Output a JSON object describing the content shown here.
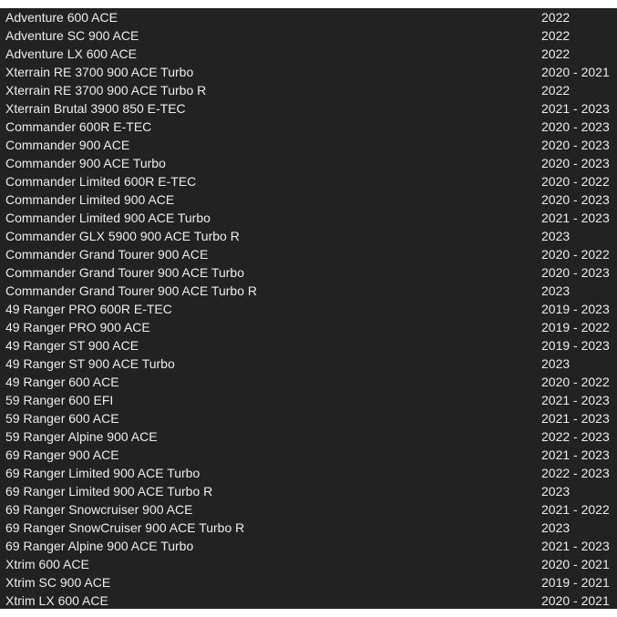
{
  "rows": [
    {
      "model": "Adventure 600 ACE",
      "years": "2022"
    },
    {
      "model": "Adventure SC 900 ACE",
      "years": "2022"
    },
    {
      "model": "Adventure LX 600 ACE",
      "years": "2022"
    },
    {
      "model": "Xterrain RE 3700 900 ACE Turbo",
      "years": "2020 - 2021"
    },
    {
      "model": "Xterrain RE 3700 900 ACE Turbo R",
      "years": "2022"
    },
    {
      "model": "Xterrain Brutal 3900 850 E-TEC",
      "years": "2021 - 2023"
    },
    {
      "model": "Commander 600R E-TEC",
      "years": "2020 - 2023"
    },
    {
      "model": "Commander 900 ACE",
      "years": "2020 - 2023"
    },
    {
      "model": "Commander 900 ACE Turbo",
      "years": "2020 - 2023"
    },
    {
      "model": "Commander Limited 600R E-TEC",
      "years": "2020 - 2022"
    },
    {
      "model": "Commander Limited 900 ACE",
      "years": "2020 - 2023"
    },
    {
      "model": "Commander Limited 900 ACE Turbo",
      "years": "2021 - 2023"
    },
    {
      "model": "Commander GLX 5900 900 ACE Turbo R",
      "years": "2023"
    },
    {
      "model": "Commander Grand Tourer 900 ACE",
      "years": "2020 - 2022"
    },
    {
      "model": "Commander Grand Tourer 900 ACE Turbo",
      "years": "2020 - 2023"
    },
    {
      "model": "Commander Grand Tourer 900 ACE Turbo R",
      "years": "2023"
    },
    {
      "model": "49 Ranger PRO 600R E-TEC",
      "years": "2019 - 2023"
    },
    {
      "model": "49 Ranger PRO 900 ACE",
      "years": "2019 - 2022"
    },
    {
      "model": "49 Ranger ST 900 ACE",
      "years": "2019 - 2023"
    },
    {
      "model": "49 Ranger ST 900 ACE Turbo",
      "years": "2023"
    },
    {
      "model": "49 Ranger 600 ACE",
      "years": "2020 - 2022"
    },
    {
      "model": "59 Ranger 600 EFI",
      "years": "2021 - 2023"
    },
    {
      "model": "59 Ranger 600 ACE",
      "years": "2021 - 2023"
    },
    {
      "model": "59 Ranger Alpine 900 ACE",
      "years": "2022 - 2023"
    },
    {
      "model": "69 Ranger 900 ACE",
      "years": "2021 - 2023"
    },
    {
      "model": "69 Ranger Limited 900 ACE Turbo",
      "years": "2022 - 2023"
    },
    {
      "model": "69 Ranger Limited 900 ACE Turbo R",
      "years": "2023"
    },
    {
      "model": "69 Ranger Snowcruiser 900 ACE",
      "years": "2021 - 2022"
    },
    {
      "model": "69 Ranger SnowCruiser 900 ACE Turbo R",
      "years": "2023"
    },
    {
      "model": "69 Ranger Alpine 900 ACE Turbo",
      "years": "2021 - 2023"
    },
    {
      "model": "Xtrim 600 ACE",
      "years": "2020 - 2021"
    },
    {
      "model": "Xtrim SC 900 ACE",
      "years": "2019 - 2021"
    },
    {
      "model": "Xtrim LX 600 ACE",
      "years": "2020 - 2021"
    }
  ],
  "colors": {
    "panel_background": "#222222",
    "text": "#ececec",
    "page_background": "#ffffff"
  }
}
